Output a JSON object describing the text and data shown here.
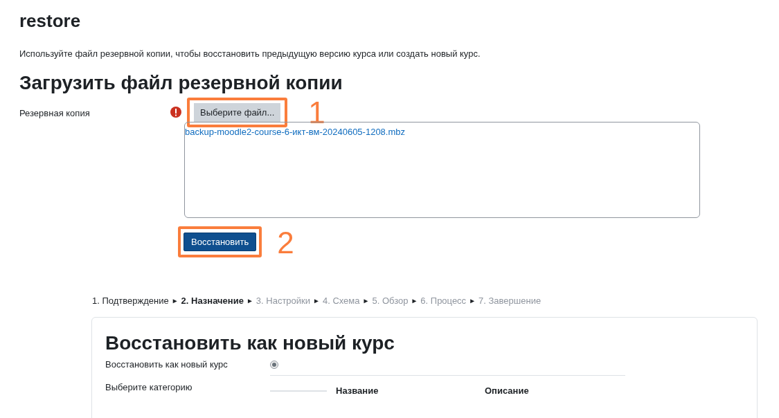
{
  "page_title": "restore",
  "intro": "Используйте файл резервной копии, чтобы восстановить предыдущую версию курса или создать новый курс.",
  "upload": {
    "heading": "Загрузить файл резервной копии",
    "label": "Резервная копия",
    "required": true,
    "choose_button": {
      "label": "Выберите файл...",
      "callout": "1"
    },
    "file": "backup-moodle2-course-6-икт-вм-20240605-1208.mbz",
    "restore_button": {
      "label": "Восстановить",
      "callout": "2"
    }
  },
  "steps": [
    {
      "label": "1. Подтверждение",
      "selected": false,
      "disabled": false,
      "separator": "►"
    },
    {
      "label": "2. Назначение",
      "selected": true,
      "disabled": false,
      "separator": "►"
    },
    {
      "label": "3. Настройки",
      "selected": false,
      "disabled": true,
      "separator": "►"
    },
    {
      "label": "4. Схема",
      "selected": false,
      "disabled": true,
      "separator": "►"
    },
    {
      "label": "5. Обзор",
      "selected": false,
      "disabled": true,
      "separator": "►"
    },
    {
      "label": "6. Процесс",
      "selected": false,
      "disabled": true,
      "separator": "►"
    },
    {
      "label": "7. Завершение",
      "selected": false,
      "disabled": true
    }
  ],
  "card": {
    "heading": "Восстановить как новый курс",
    "option": {
      "label": "Восстановить как новый курс",
      "selected": true
    },
    "category_label": "Выберите категорию",
    "columns": [
      "Название",
      "Описание"
    ]
  }
}
